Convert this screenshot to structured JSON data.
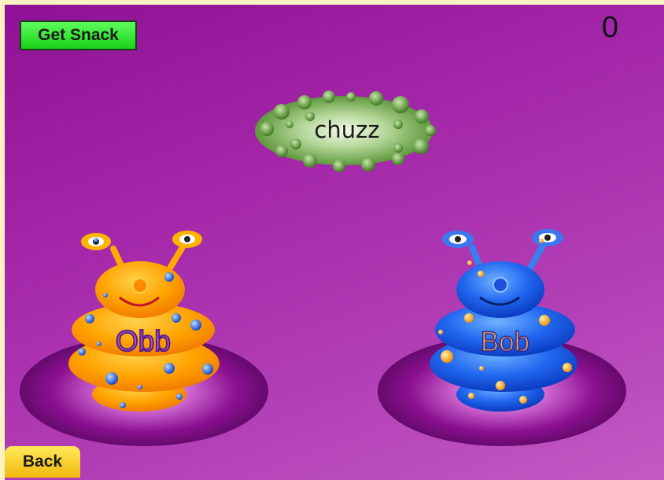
{
  "controls": {
    "get_snack_label": "Get Snack",
    "back_label": "Back"
  },
  "score": "0",
  "snack": {
    "word": "chuzz",
    "icon": "green-cookie-icon"
  },
  "monsters": [
    {
      "name": "Obb",
      "color": "orange",
      "icon": "orange-monster-icon"
    },
    {
      "name": "Bob",
      "color": "blue",
      "icon": "blue-monster-icon"
    }
  ]
}
